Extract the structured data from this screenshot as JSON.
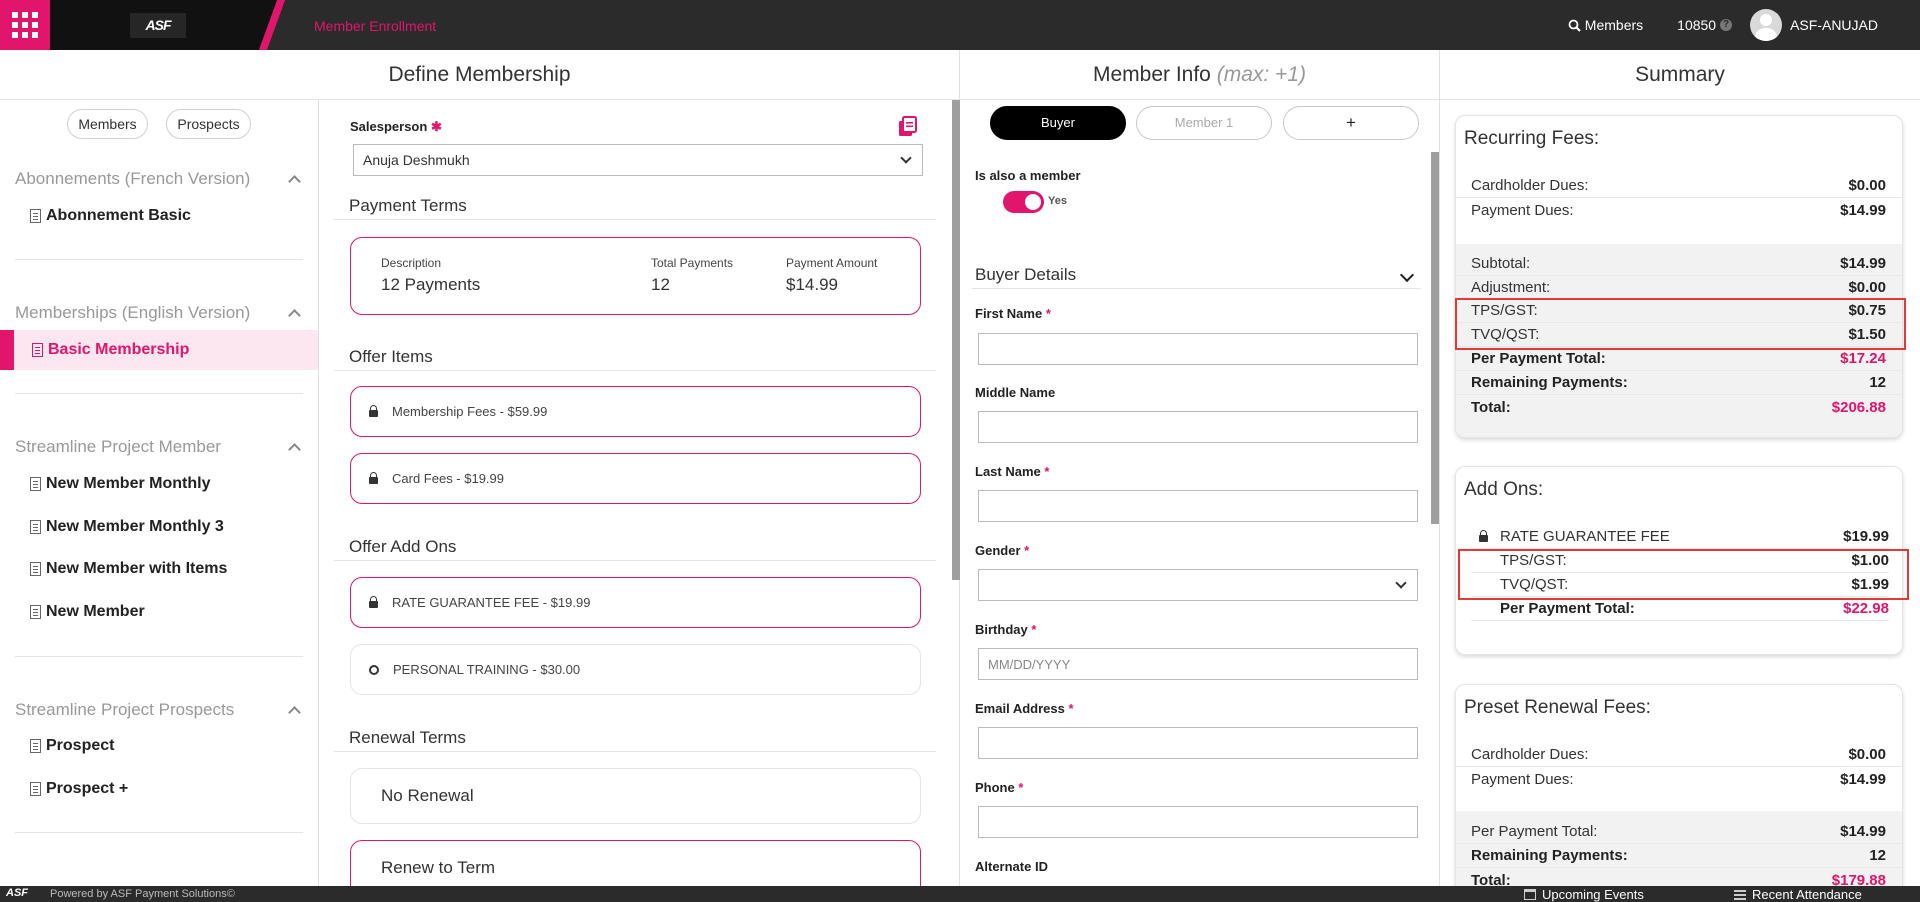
{
  "header": {
    "app_title": "Member Enrollment",
    "logo_text": "ASF",
    "members_link": "Members",
    "club_id": "10850",
    "club_help": "?",
    "user_name": "ASF-ANUJAD"
  },
  "columns": {
    "define": "Define Membership",
    "member_info": "Member Info",
    "member_info_hint": "(max: +1)",
    "summary": "Summary"
  },
  "left_nav": {
    "pills": [
      "Members",
      "Prospects"
    ],
    "groups": [
      {
        "title": "Abonnements (French Version)",
        "items": [
          "Abonnement Basic"
        ]
      },
      {
        "title": "Memberships (English Version)",
        "items": [
          "Basic Membership"
        ]
      },
      {
        "title": "Streamline Project Member",
        "items": [
          "New Member Monthly",
          "New Member Monthly 3",
          "New Member with Items",
          "New Member"
        ]
      },
      {
        "title": "Streamline Project Prospects",
        "items": [
          "Prospect",
          "Prospect +"
        ]
      }
    ]
  },
  "define": {
    "salesperson_label": "Salesperson",
    "salesperson_value": "Anuja Deshmukh",
    "payment_terms_title": "Payment Terms",
    "payment_terms": {
      "desc_label": "Description",
      "desc_value": "12 Payments",
      "total_label": "Total Payments",
      "total_value": "12",
      "amount_label": "Payment Amount",
      "amount_value": "$14.99"
    },
    "offer_items_title": "Offer Items",
    "offer_items": [
      "Membership Fees - $59.99",
      "Card Fees - $19.99"
    ],
    "offer_addons_title": "Offer Add Ons",
    "offer_addons": [
      "RATE GUARANTEE FEE - $19.99",
      "PERSONAL TRAINING - $30.00"
    ],
    "renewal_title": "Renewal Terms",
    "renewal_options": [
      "No Renewal",
      "Renew to Term"
    ]
  },
  "member_info": {
    "tabs": [
      "Buyer",
      "Member 1",
      "+"
    ],
    "also_member_label": "Is also a member",
    "toggle_text": "Yes",
    "buyer_details_title": "Buyer Details",
    "fields": [
      {
        "label": "First Name",
        "required": "*",
        "placeholder": ""
      },
      {
        "label": "Middle Name",
        "required": "",
        "placeholder": ""
      },
      {
        "label": "Last Name",
        "required": "*",
        "placeholder": ""
      },
      {
        "label": "Gender",
        "required": "*",
        "placeholder": ""
      },
      {
        "label": "Birthday",
        "required": "*",
        "placeholder": "MM/DD/YYYY"
      },
      {
        "label": "Email Address",
        "required": "*",
        "placeholder": ""
      },
      {
        "label": "Phone",
        "required": "*",
        "placeholder": ""
      },
      {
        "label": "Alternate ID",
        "required": "",
        "placeholder": ""
      }
    ]
  },
  "summary": {
    "recurring": {
      "title": "Recurring Fees:",
      "cardholder_label": "Cardholder Dues:",
      "cardholder_value": "$0.00",
      "payment_label": "Payment Dues:",
      "payment_value": "$14.99",
      "subtotal_label": "Subtotal:",
      "subtotal_value": "$14.99",
      "adjustment_label": "Adjustment:",
      "adjustment_value": "$0.00",
      "tps_label": "TPS/GST:",
      "tps_value": "$0.75",
      "tvq_label": "TVQ/QST:",
      "tvq_value": "$1.50",
      "per_payment_label": "Per Payment Total:",
      "per_payment_value": "$17.24",
      "remaining_label": "Remaining Payments:",
      "remaining_value": "12",
      "total_label": "Total:",
      "total_value": "$206.88"
    },
    "addons": {
      "title": "Add Ons:",
      "fee_label": "RATE GUARANTEE FEE",
      "fee_value": "$19.99",
      "tps_label": "TPS/GST:",
      "tps_value": "$1.00",
      "tvq_label": "TVQ/QST:",
      "tvq_value": "$1.99",
      "per_payment_label": "Per Payment Total:",
      "per_payment_value": "$22.98"
    },
    "renewal": {
      "title": "Preset Renewal Fees:",
      "cardholder_label": "Cardholder Dues:",
      "cardholder_value": "$0.00",
      "payment_label": "Payment Dues:",
      "payment_value": "$14.99",
      "per_payment_label": "Per Payment Total:",
      "per_payment_value": "$14.99",
      "remaining_label": "Remaining Payments:",
      "remaining_value": "12",
      "total_label": "Total:",
      "total_value": "$179.88"
    }
  },
  "footer": {
    "logo_text": "ASF",
    "powered": "Powered by ASF Payment Solutions©",
    "upcoming": "Upcoming Events",
    "attendance": "Recent Attendance"
  },
  "colors": {
    "accent": "#e0156b",
    "topbar": "#2b2b2b",
    "highlight_box": "#e53935"
  }
}
